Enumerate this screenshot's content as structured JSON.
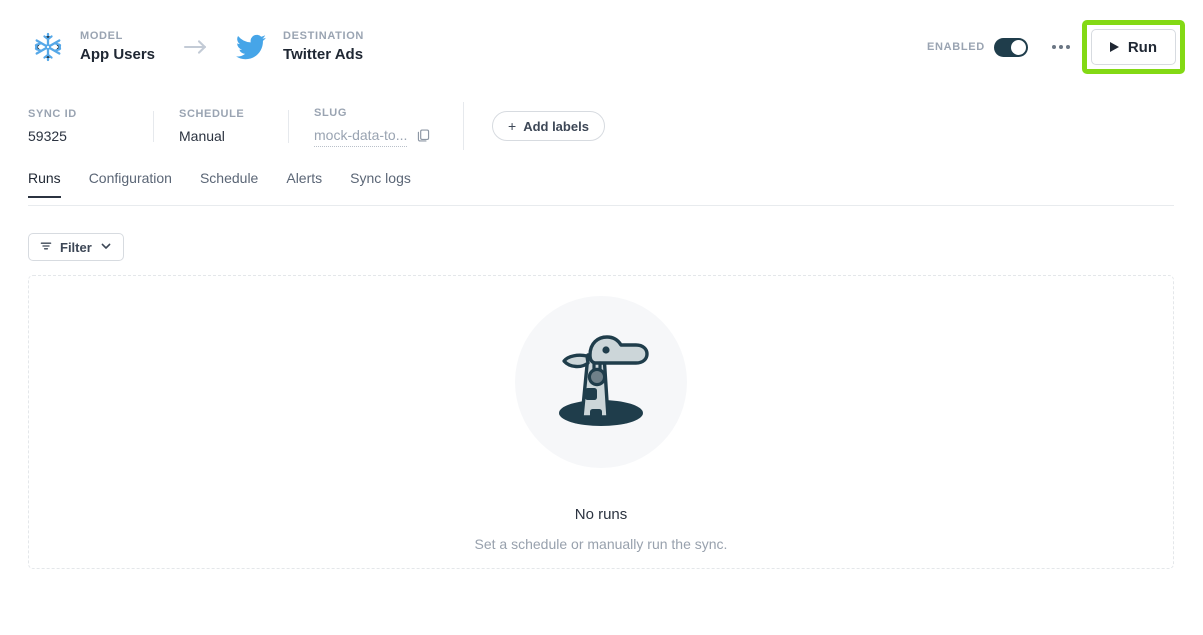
{
  "header": {
    "model": {
      "kicker": "MODEL",
      "name": "App Users",
      "logo_icon": "snowflake-icon",
      "logo_color": "#56a8e8"
    },
    "arrow_icon": "arrow-right-icon",
    "destination": {
      "kicker": "DESTINATION",
      "name": "Twitter Ads",
      "logo_icon": "twitter-bird-icon",
      "logo_color": "#46a5e8"
    },
    "enabled_label": "ENABLED",
    "enabled_state": "on",
    "toggle_color": "#1f3d4b",
    "overflow_icon": "kebab-menu-icon",
    "run_label": "Run",
    "run_icon": "play-icon",
    "annotation_color": "#83d914"
  },
  "meta": {
    "sync_id": {
      "label": "SYNC ID",
      "value": "59325"
    },
    "schedule": {
      "label": "SCHEDULE",
      "value": "Manual"
    },
    "slug": {
      "label": "SLUG",
      "value": "mock-data-to...",
      "copy_icon": "copy-icon"
    },
    "add_labels": {
      "label": "Add labels",
      "icon": "plus-icon"
    }
  },
  "tabs": [
    {
      "label": "Runs",
      "active": true
    },
    {
      "label": "Configuration",
      "active": false
    },
    {
      "label": "Schedule",
      "active": false
    },
    {
      "label": "Alerts",
      "active": false
    },
    {
      "label": "Sync logs",
      "active": false
    }
  ],
  "filter": {
    "label": "Filter",
    "icon": "funnel-icon",
    "chevron": "chevron-down-icon"
  },
  "empty_state": {
    "illustration": "giraffe-illustration",
    "title": "No runs",
    "subtitle": "Set a schedule or manually run the sync.",
    "circle_color": "#f6f7f9",
    "figure_dark": "#1f3d4b",
    "figure_light": "#ccd6d9"
  }
}
